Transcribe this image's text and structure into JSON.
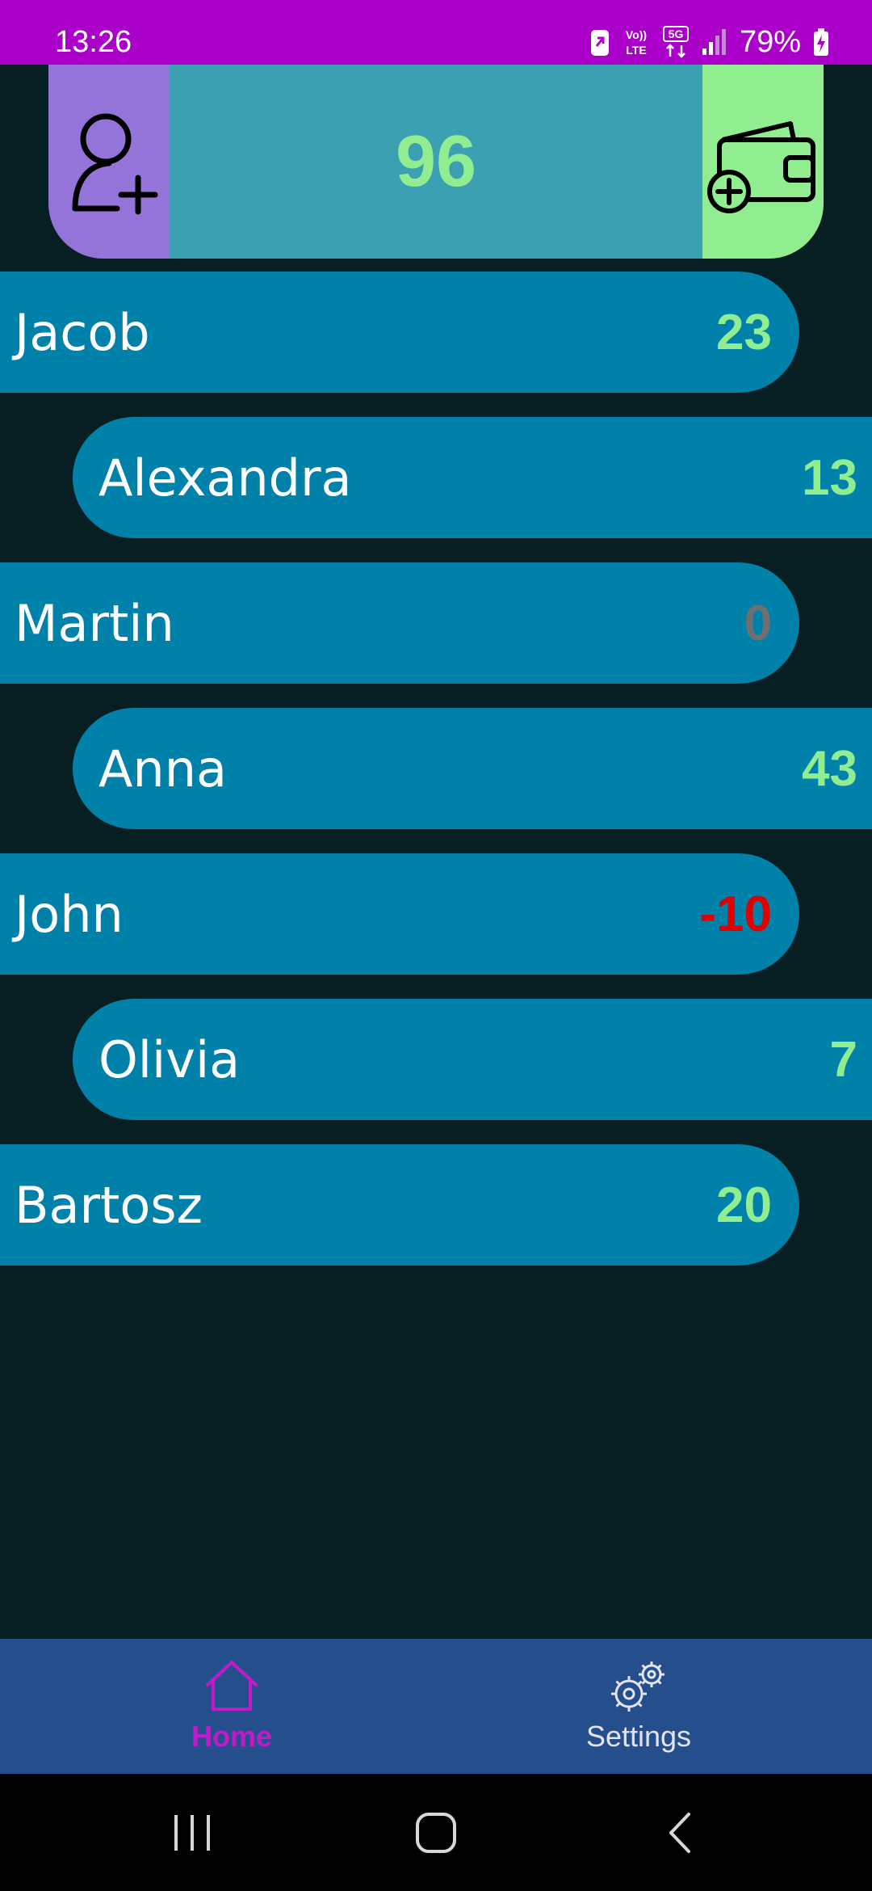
{
  "status_bar": {
    "time": "13:26",
    "battery": "79%",
    "icons": [
      "data-saver-icon",
      "volte-icon",
      "5g-icon",
      "signal-icon",
      "battery-charging-icon"
    ]
  },
  "header": {
    "add_user_icon": "person-add-icon",
    "balance": "96",
    "add_wallet_icon": "wallet-add-icon"
  },
  "people": [
    {
      "name": "Jacob",
      "balance": "23"
    },
    {
      "name": "Alexandra",
      "balance": "13"
    },
    {
      "name": "Martin",
      "balance": "0"
    },
    {
      "name": "Anna",
      "balance": "43"
    },
    {
      "name": "John",
      "balance": "-10"
    },
    {
      "name": "Olivia",
      "balance": "7"
    },
    {
      "name": "Bartosz",
      "balance": "20"
    }
  ],
  "bottom_nav": {
    "home_label": "Home",
    "settings_label": "Settings",
    "home_icon": "home-icon",
    "settings_icon": "gear-icon"
  },
  "colors": {
    "status_bar": "#aa00c9",
    "background": "#071e23",
    "add_user_panel": "#9474d8",
    "balance_panel": "#3aa0b2",
    "wallet_panel": "#90ee90",
    "row": "#0081a9",
    "positive": "#90ee90",
    "zero": "#6f6f6f",
    "negative": "#e00000",
    "nav_bar": "#254e8d",
    "nav_active": "#c21ac8"
  },
  "system_nav": {
    "icons": [
      "recents-icon",
      "home-button-icon",
      "back-icon"
    ]
  }
}
